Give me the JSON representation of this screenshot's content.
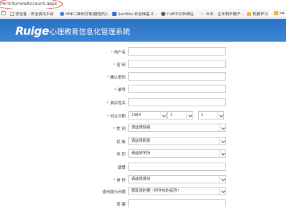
{
  "browser": {
    "url": "PerInfo/newAccount.aspx",
    "bookmarks": [
      {
        "label": "",
        "icon": "page-icon"
      },
      {
        "label": "安全客 - 安全资讯平台",
        "icon": "page-icon"
      },
      {
        "label": "PHP二维码引擎/超短的2...",
        "icon": "blue-globe-icon"
      },
      {
        "label": "SecWiki-安全维基,汇...",
        "icon": "pin-icon"
      },
      {
        "label": "CVE中文申请站",
        "icon": "globe-icon"
      },
      {
        "label": "补天 - 企业和白帽子...",
        "icon": "star-icon"
      },
      {
        "label": "机器学习",
        "icon": "folder-icon"
      },
      {
        "label": "ca",
        "icon": "folder-icon"
      }
    ]
  },
  "header": {
    "logo": "Ruige",
    "title": "心理教育信息化管理系统",
    "bg_color": "#2f79cc"
  },
  "form": {
    "username_label": "用户名",
    "password_label": "密  码",
    "confirm_password_label": "确认密码",
    "id_label": "编号",
    "realname_label": "真实姓名",
    "birthdate_label": "出生日期",
    "birth_year": "1980",
    "birth_month": "1",
    "birth_day": "1",
    "gender_label": "性  别",
    "gender_value": "请选择性别",
    "ethnicity_label": "民  族",
    "ethnicity_value": "请选择民族",
    "education_label": "学  历",
    "education_value": "请选择学历",
    "occupation_label": "籍贯",
    "identity_label": "身  份",
    "identity_value": "请选择身份",
    "question_label": "密码提示问题",
    "question_value": "我就读的第一所学校的名称?",
    "answer_label": "答  案",
    "required_color": "#e0261b"
  }
}
